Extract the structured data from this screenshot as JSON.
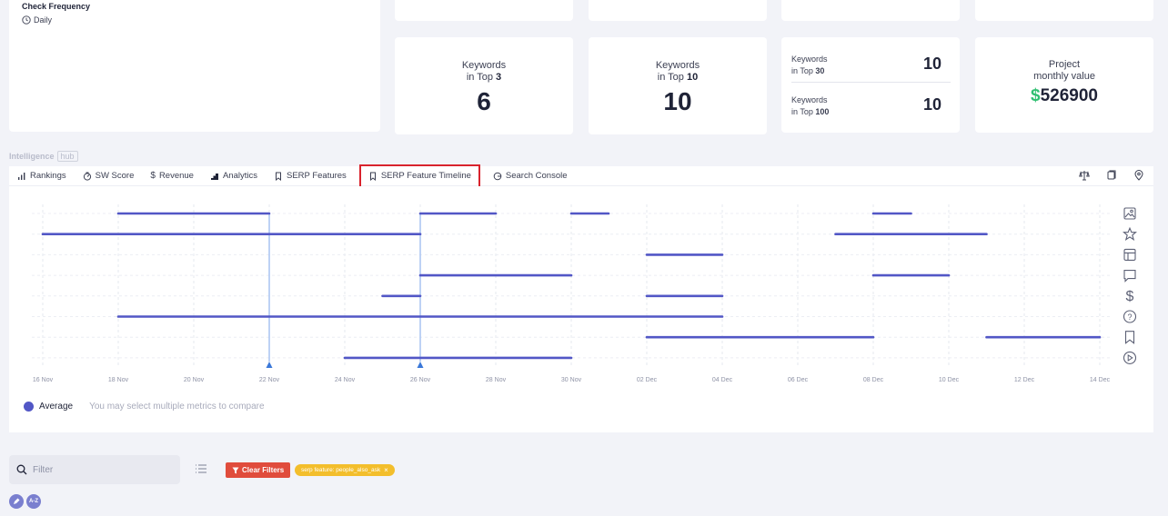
{
  "check": {
    "label": "Check Frequency",
    "value": "Daily"
  },
  "stats": {
    "top3": {
      "line1": "Keywords",
      "line2_prefix": "in Top ",
      "line2_bold": "3",
      "value": "6"
    },
    "top10": {
      "line1": "Keywords",
      "line2_prefix": "in Top ",
      "line2_bold": "10",
      "value": "10"
    },
    "top30": {
      "line1": "Keywords",
      "line2_prefix": "in Top ",
      "line2_bold": "30",
      "value": "10"
    },
    "top100": {
      "line1": "Keywords",
      "line2_prefix": "in Top ",
      "line2_bold": "100",
      "value": "10"
    },
    "monthly": {
      "line1": "Project",
      "line2": "monthly value",
      "currency": "$",
      "value": "526900"
    }
  },
  "hub": {
    "title": "Intelligence",
    "badge": "hub"
  },
  "tabs": [
    {
      "label": "Rankings",
      "icon": "bar-chart-icon"
    },
    {
      "label": "SW Score",
      "icon": "gauge-icon"
    },
    {
      "label": "Revenue",
      "icon": "dollar-icon"
    },
    {
      "label": "Analytics",
      "icon": "analytics-icon"
    },
    {
      "label": "SERP Features",
      "icon": "bookmark-icon"
    },
    {
      "label": "SERP Feature Timeline",
      "icon": "bookmark-icon"
    },
    {
      "label": "Search Console",
      "icon": "google-icon"
    }
  ],
  "chart_data": {
    "type": "timeline",
    "x_ticks": [
      "16 Nov",
      "18 Nov",
      "20 Nov",
      "22 Nov",
      "24 Nov",
      "26 Nov",
      "28 Nov",
      "30 Nov",
      "02 Dec",
      "04 Dec",
      "06 Dec",
      "08 Dec",
      "10 Dec",
      "12 Dec",
      "14 Dec"
    ],
    "x_range": [
      "2023-11-16",
      "2023-12-14"
    ],
    "rows": [
      {
        "feature": "image-icon",
        "segments": [
          [
            "2023-11-18",
            "2023-11-22"
          ],
          [
            "2023-11-26",
            "2023-11-28"
          ],
          [
            "2023-11-30",
            "2023-11-30"
          ],
          [
            "2023-12-08",
            "2023-12-09"
          ]
        ]
      },
      {
        "feature": "star-icon",
        "segments": [
          [
            "2023-11-16",
            "2023-11-26"
          ],
          [
            "2023-12-07",
            "2023-12-11"
          ]
        ]
      },
      {
        "feature": "layout-icon",
        "segments": [
          [
            "2023-12-02",
            "2023-12-04"
          ]
        ]
      },
      {
        "feature": "comment-icon",
        "segments": [
          [
            "2023-11-26",
            "2023-11-30"
          ],
          [
            "2023-12-08",
            "2023-12-10"
          ]
        ]
      },
      {
        "feature": "dollar-icon",
        "segments": [
          [
            "2023-11-25",
            "2023-11-26"
          ],
          [
            "2023-12-02",
            "2023-12-04"
          ]
        ]
      },
      {
        "feature": "question-icon",
        "segments": [
          [
            "2023-11-18",
            "2023-12-04"
          ]
        ]
      },
      {
        "feature": "bookmark-icon",
        "segments": [
          [
            "2023-12-02",
            "2023-12-08"
          ],
          [
            "2023-12-11",
            "2023-12-14"
          ]
        ]
      },
      {
        "feature": "play-icon",
        "segments": [
          [
            "2023-11-24",
            "2023-11-30"
          ]
        ]
      }
    ],
    "markers": [
      "2023-11-22",
      "2023-11-26"
    ],
    "color": "#5257c6"
  },
  "legend": {
    "label": "Average",
    "hint": "You may select multiple metrics to compare"
  },
  "filter": {
    "placeholder": "Filter"
  },
  "clear_filters": "Clear Filters",
  "active_tag": "serp feature: people_also_ask",
  "sort_label": "A-Z",
  "colors": {
    "accent": "#5257c6",
    "danger": "#e04c3c",
    "tag": "#f3be2c",
    "money": "#2fbf71"
  }
}
